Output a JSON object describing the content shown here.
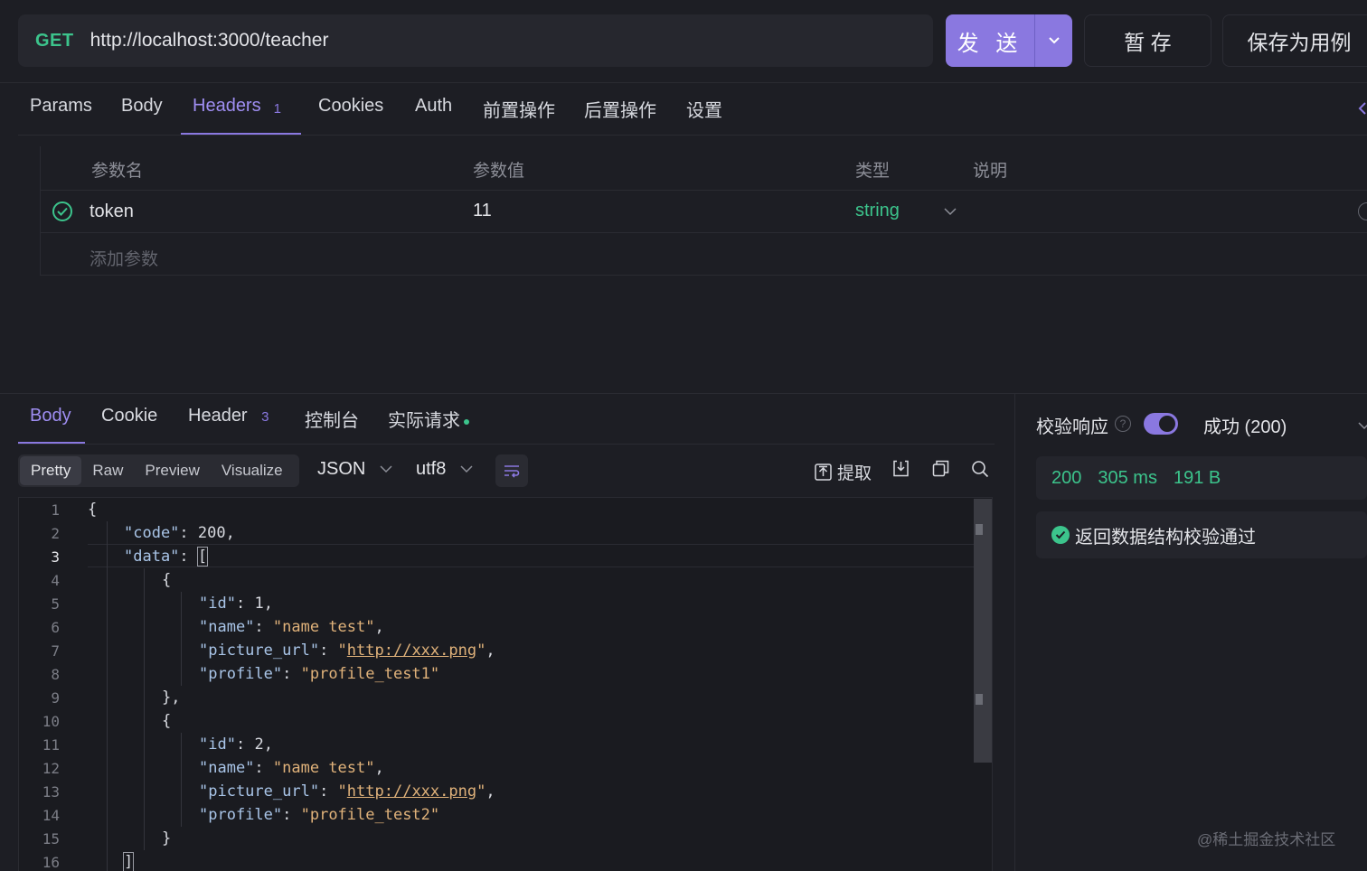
{
  "request": {
    "method": "GET",
    "url": "http://localhost:3000/teacher",
    "send_label": "发 送",
    "stash_label": "暂 存",
    "save_case_label": "保存为用例"
  },
  "request_tabs": [
    {
      "label": "Params"
    },
    {
      "label": "Body"
    },
    {
      "label": "Headers",
      "count": "1",
      "active": true
    },
    {
      "label": "Cookies"
    },
    {
      "label": "Auth"
    },
    {
      "label": "前置操作"
    },
    {
      "label": "后置操作"
    },
    {
      "label": "设置"
    }
  ],
  "headers_table": {
    "columns": [
      "参数名",
      "参数值",
      "类型",
      "说明"
    ],
    "rows": [
      {
        "name": "token",
        "value": "11",
        "type": "string",
        "description": ""
      }
    ],
    "add_placeholder": "添加参数"
  },
  "response_tabs": [
    {
      "label": "Body",
      "active": true
    },
    {
      "label": "Cookie"
    },
    {
      "label": "Header",
      "count": "3"
    },
    {
      "label": "控制台"
    },
    {
      "label": "实际请求"
    }
  ],
  "view_modes": [
    "Pretty",
    "Raw",
    "Preview",
    "Visualize"
  ],
  "active_view_mode": "Pretty",
  "format_select": "JSON",
  "encoding_select": "utf8",
  "tools": {
    "extract_label": "提取"
  },
  "code_lines": [
    "1",
    "2",
    "3",
    "4",
    "5",
    "6",
    "7",
    "8",
    "9",
    "10",
    "11",
    "12",
    "13",
    "14",
    "15",
    "16"
  ],
  "code": {
    "l1": "{",
    "code_key": "\"code\"",
    "code_val": "200",
    "data_key": "\"data\"",
    "open_bracket": "[",
    "brace_open": "{",
    "id_key": "\"id\"",
    "id1": "1",
    "id2": "2",
    "name_key": "\"name\"",
    "name_val": "\"name test\"",
    "pic_key": "\"picture_url\"",
    "pic_val": "http://xxx.png",
    "profile_key": "\"profile\"",
    "profile1": "\"profile_test1\"",
    "profile2": "\"profile_test2\"",
    "brace_close_comma": "},",
    "brace_close": "}",
    "close_bracket": "]"
  },
  "validation": {
    "label": "校验响应",
    "status_text": "成功 (200)",
    "status_code": "200",
    "time": "305 ms",
    "size": "191 B",
    "result": "返回数据结构校验通过"
  },
  "watermark": "@稀土掘金技术社区",
  "colors": {
    "accent": "#8a78e0",
    "success": "#3cc48c",
    "string": "#e0b27a",
    "key": "#a9c5e8"
  }
}
